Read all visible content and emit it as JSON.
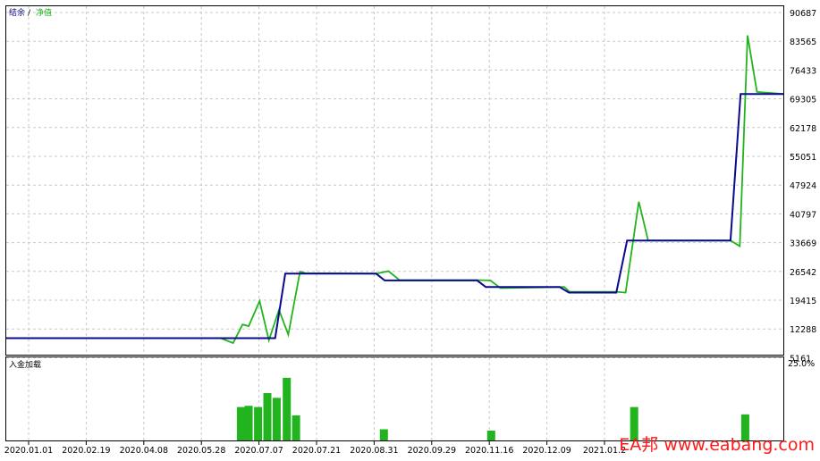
{
  "legend": {
    "balance": "结余",
    "separator": "/",
    "equity": "净值",
    "deposit_load": "入金加载"
  },
  "watermark": "EA邦 www.eabang.com",
  "colors": {
    "balance": "#0a0a8c",
    "equity": "#22b41e",
    "deposit_bar": "#22b41e",
    "grid": "#c8c8c8",
    "frame": "#000000",
    "watermark": "#ff1a1a"
  },
  "chart_data": [
    {
      "type": "line",
      "title": "",
      "y_ticks": [
        "90687",
        "83565",
        "76433",
        "69305",
        "62178",
        "55051",
        "47924",
        "40797",
        "33669",
        "26542",
        "19415",
        "12288",
        "5161"
      ],
      "ylim": [
        5161,
        90687
      ],
      "x_ticks": [
        "2020.01.01",
        "2020.02.19",
        "2020.04.08",
        "2020.05.28",
        "2020.07.07",
        "2020.07.21",
        "2020.08.31",
        "2020.09.29",
        "2020.11.16",
        "2020.12.09",
        "2021.01.2"
      ],
      "xlim": [
        0,
        100
      ],
      "grid": true,
      "series": [
        {
          "name": "结余",
          "points": [
            [
              0,
              10000
            ],
            [
              27.8,
              10000
            ],
            [
              34.6,
              10000
            ],
            [
              35.9,
              26000
            ],
            [
              47.6,
              26000
            ],
            [
              48.7,
              24300
            ],
            [
              60.6,
              24300
            ],
            [
              61.7,
              22700
            ],
            [
              71.2,
              22700
            ],
            [
              72.4,
              21300
            ],
            [
              78.5,
              21300
            ],
            [
              79.9,
              34200
            ],
            [
              93.2,
              34200
            ],
            [
              94.5,
              70500
            ],
            [
              100,
              70500
            ]
          ]
        },
        {
          "name": "净值",
          "points": [
            [
              0,
              10000
            ],
            [
              27.6,
              10000
            ],
            [
              29.2,
              8800
            ],
            [
              30.4,
              13400
            ],
            [
              31.2,
              13000
            ],
            [
              32.6,
              19200
            ],
            [
              33.8,
              9500
            ],
            [
              35.1,
              17000
            ],
            [
              36.3,
              10900
            ],
            [
              37.8,
              26500
            ],
            [
              38.5,
              26100
            ],
            [
              47.6,
              26000
            ],
            [
              49.2,
              26600
            ],
            [
              50.6,
              24400
            ],
            [
              60.6,
              24400
            ],
            [
              62.3,
              24300
            ],
            [
              63.6,
              22400
            ],
            [
              71.8,
              22700
            ],
            [
              72.5,
              21500
            ],
            [
              78.5,
              21500
            ],
            [
              79.7,
              21300
            ],
            [
              81.4,
              43800
            ],
            [
              82.6,
              34200
            ],
            [
              93.2,
              34200
            ],
            [
              94.4,
              32800
            ],
            [
              95.4,
              85000
            ],
            [
              96.6,
              71000
            ],
            [
              100,
              70500
            ]
          ]
        }
      ]
    },
    {
      "type": "bar",
      "title": "",
      "y_tick": "25.0%",
      "ylim": [
        0,
        25
      ],
      "values_x": [
        30.2,
        31.2,
        32.4,
        33.6,
        34.8,
        36.1,
        37.3,
        48.6,
        62.4,
        80.8,
        95.1
      ],
      "values": [
        10.5,
        10.9,
        10.5,
        14.9,
        13.4,
        19.7,
        7.9,
        3.5,
        3.1,
        10.5,
        8.2
      ]
    }
  ]
}
